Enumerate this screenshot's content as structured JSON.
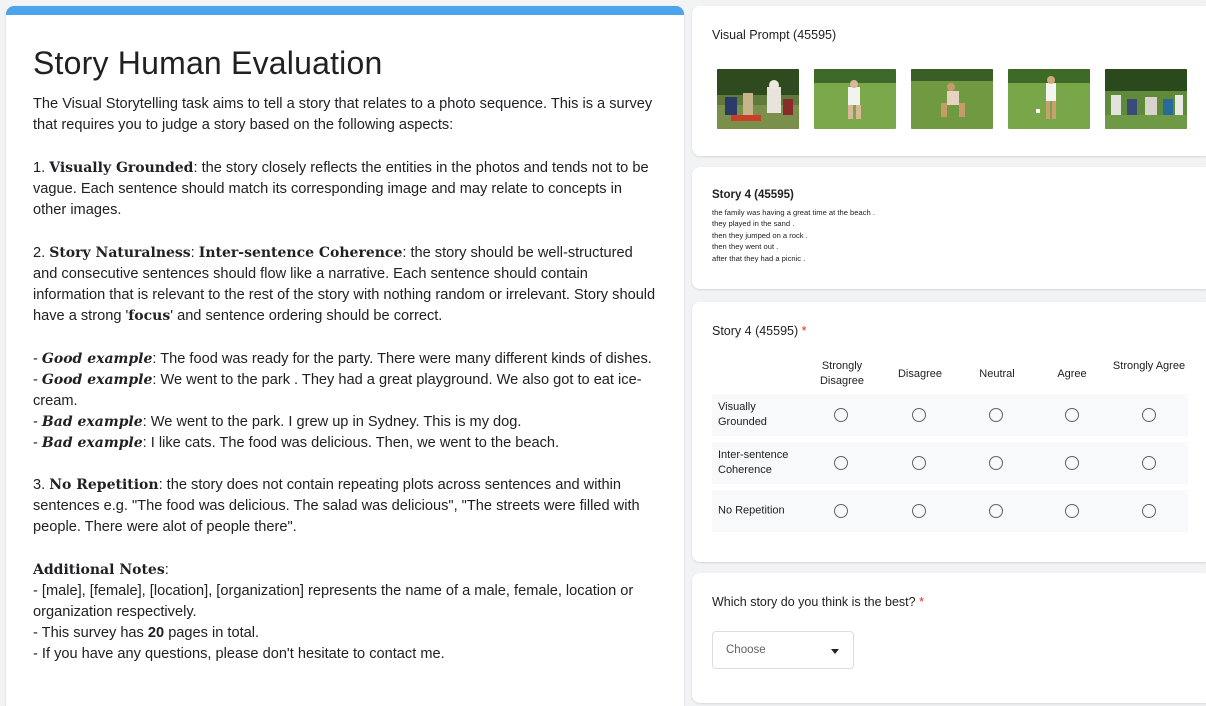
{
  "instructions": {
    "title": "Story Human Evaluation",
    "intro": "The Visual Storytelling task aims to tell a story that relates to a photo sequence. This is a survey that requires you to judge a story based on the following aspects:",
    "aspect1_prefix": "1. ",
    "aspect1_term": "Visually Grounded",
    "aspect1_text": ": the story closely reflects the entities in the photos and tends not to be vague. Each sentence should match its corresponding image and may relate to concepts in other images.",
    "aspect2_prefix": "2. ",
    "aspect2_term1": "Story Naturalness",
    "aspect2_sep": ": ",
    "aspect2_term2": "Inter-sentence Coherence",
    "aspect2_text": ": the story should be well-structured and consecutive sentences should flow like  a narrative. Each sentence should contain information that is relevant to the rest of the story with nothing random or irrelevant. Story should have a strong '",
    "aspect2_focus": "focus",
    "aspect2_end": "' and sentence ordering should be correct.",
    "examples": [
      {
        "dash": "- ",
        "label": "Good example",
        "text": ": The food was ready for the party. There were many different kinds of dishes."
      },
      {
        "dash": "- ",
        "label": "Good example",
        "text": ": We went to the park . They had a great playground. We also got to eat ice-cream."
      },
      {
        "dash": "- ",
        "label": "Bad example",
        "text": ": We went to the park. I grew up in Sydney. This is my dog."
      },
      {
        "dash": "- ",
        "label": "Bad example",
        "text": ": I like cats. The food was delicious. Then, we went to the beach."
      }
    ],
    "aspect3_prefix": "3. ",
    "aspect3_term": "No Repetition",
    "aspect3_text": ": the story does not contain repeating plots across sentences and within sentences e.g. \"The food was delicious. The salad was delicious\",  \"The streets were filled with people. There were alot of people there\".",
    "notes_title": "Additional Notes",
    "notes_colon": ":",
    "note1": "- [male], [female], [location], [organization] represents the name of a male, female, location or organization respectively.",
    "note2_a": "- This survey has ",
    "note2_b": "20",
    "note2_c": " pages in total.",
    "note3": "- If you have any questions, please don't hesitate to contact me."
  },
  "visual_prompt": {
    "title": "Visual Prompt (45595)"
  },
  "story": {
    "title": "Story 4 (45595)",
    "lines": [
      "the family was having a great time at the beach .",
      "they played in the sand .",
      "then they jumped on a rock .",
      "then they went out .",
      "after that they had a picnic ."
    ]
  },
  "grid": {
    "title": "Story 4 (45595)",
    "required": "*",
    "columns": [
      "Strongly Disagree",
      "Disagree",
      "Neutral",
      "Agree",
      "Strongly Agree"
    ],
    "rows": [
      "Visually Grounded",
      "Inter-sentence Coherence",
      "No Repetition"
    ]
  },
  "best": {
    "question": "Which story do you think is the best?",
    "required": "*",
    "select_value": "Choose"
  },
  "colors": {
    "accent": "#4da3ec",
    "required": "#d93025"
  }
}
